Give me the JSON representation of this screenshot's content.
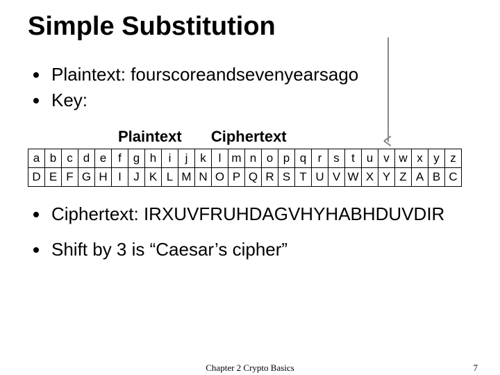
{
  "title": "Simple Substitution",
  "bullets_top": [
    "Plaintext: fourscoreandsevenyearsago",
    "Key:"
  ],
  "arrow_labels": {
    "pt": "Plaintext",
    "ct": "Ciphertext"
  },
  "table": {
    "plain": [
      "a",
      "b",
      "c",
      "d",
      "e",
      "f",
      "g",
      "h",
      "i",
      "j",
      "k",
      "l",
      "m",
      "n",
      "o",
      "p",
      "q",
      "r",
      "s",
      "t",
      "u",
      "v",
      "w",
      "x",
      "y",
      "z"
    ],
    "cipher": [
      "D",
      "E",
      "F",
      "G",
      "H",
      "I",
      "J",
      "K",
      "L",
      "M",
      "N",
      "O",
      "P",
      "Q",
      "R",
      "S",
      "T",
      "U",
      "V",
      "W",
      "X",
      "Y",
      "Z",
      "A",
      "B",
      "C"
    ]
  },
  "bullets_bottom": [
    "Ciphertext: IRXUVFRUHDAGVHYHABHDUVDIR",
    "Shift by 3 is “Caesar’s cipher”"
  ],
  "footer": {
    "chapter": "Chapter 2 Crypto Basics",
    "page": "7"
  },
  "chart_data": {
    "type": "table",
    "title": "Caesar shift key (shift by 3)",
    "columns": [
      "plaintext_letter",
      "ciphertext_letter"
    ],
    "rows": [
      [
        "a",
        "D"
      ],
      [
        "b",
        "E"
      ],
      [
        "c",
        "F"
      ],
      [
        "d",
        "G"
      ],
      [
        "e",
        "H"
      ],
      [
        "f",
        "I"
      ],
      [
        "g",
        "J"
      ],
      [
        "h",
        "K"
      ],
      [
        "i",
        "L"
      ],
      [
        "j",
        "M"
      ],
      [
        "k",
        "N"
      ],
      [
        "l",
        "O"
      ],
      [
        "m",
        "P"
      ],
      [
        "n",
        "Q"
      ],
      [
        "o",
        "R"
      ],
      [
        "p",
        "S"
      ],
      [
        "q",
        "T"
      ],
      [
        "r",
        "U"
      ],
      [
        "s",
        "V"
      ],
      [
        "t",
        "W"
      ],
      [
        "u",
        "X"
      ],
      [
        "v",
        "Y"
      ],
      [
        "w",
        "Z"
      ],
      [
        "x",
        "A"
      ],
      [
        "y",
        "B"
      ],
      [
        "z",
        "C"
      ]
    ]
  }
}
